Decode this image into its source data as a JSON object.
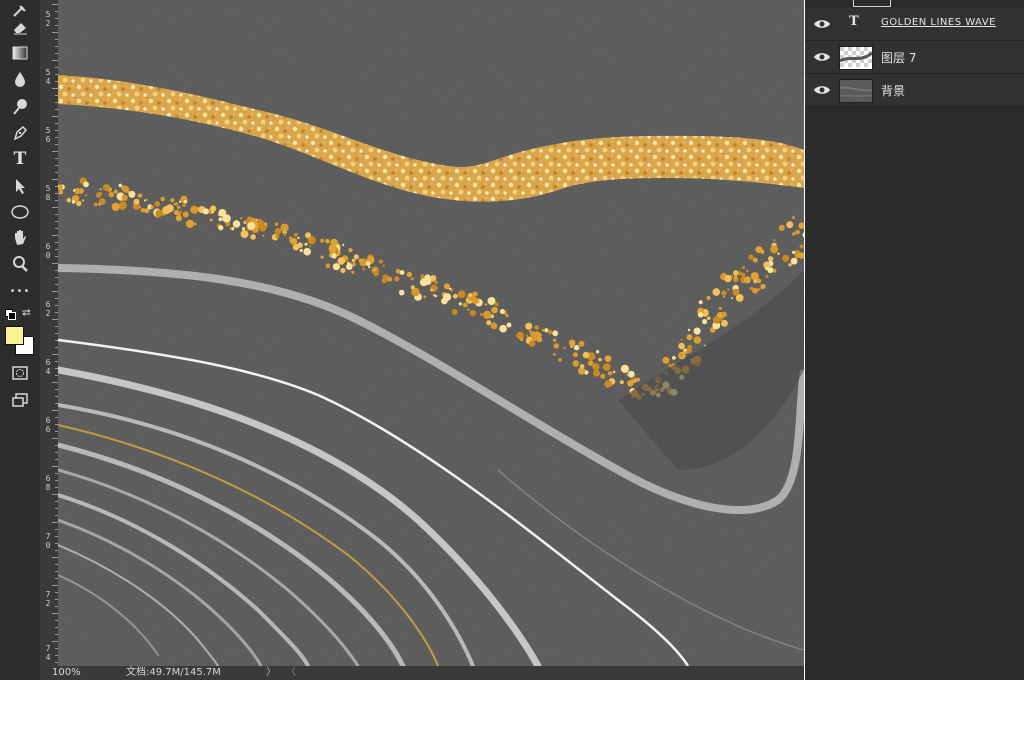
{
  "toolbar": {
    "tools": [
      {
        "icon": "healing-brush-icon"
      },
      {
        "icon": "eraser-icon"
      },
      {
        "icon": "gradient-icon"
      },
      {
        "icon": "blur-drop-icon"
      },
      {
        "icon": "dodge-icon"
      },
      {
        "icon": "pen-icon"
      },
      {
        "icon": "type-icon",
        "glyph": "T"
      },
      {
        "icon": "path-select-icon"
      },
      {
        "icon": "ellipse-icon"
      },
      {
        "icon": "hand-icon"
      },
      {
        "icon": "zoom-icon"
      },
      {
        "icon": "more-tools-icon",
        "glyph": "•••"
      }
    ],
    "foreground_color": "#fdf290",
    "background_color": "#ffffff"
  },
  "ruler": {
    "labels": [
      "5 2",
      "5 4",
      "5 6",
      "5 8",
      "6 0",
      "6 2",
      "6 4",
      "6 6",
      "6 8",
      "7 0",
      "7 2",
      "7 4"
    ]
  },
  "status": {
    "zoom": "100%",
    "doc": "文档:49.7M/145.7M",
    "arrow": "〉",
    "arrow2": "〈"
  },
  "layers": {
    "items": [
      {
        "name": "GOLDEN LINES    WAVE",
        "kind": "text",
        "type_glyph": "T"
      },
      {
        "name": "图层 7",
        "kind": "pixel"
      },
      {
        "name": "背景",
        "kind": "pixel"
      }
    ]
  },
  "colors": {
    "gold": "#e8b04a",
    "glitter": "#f2c86a",
    "canvas_gray": "#5b5b5b",
    "panel_bg": "#2b2b2b"
  }
}
